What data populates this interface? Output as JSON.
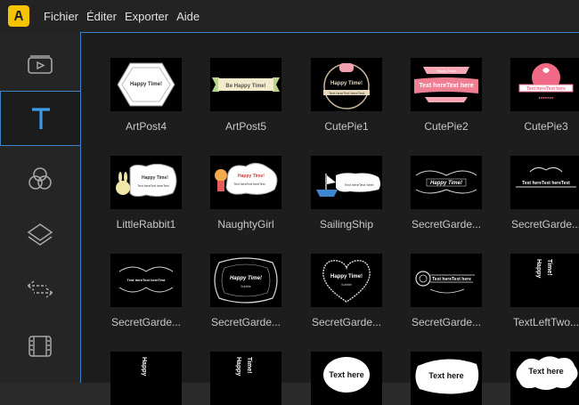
{
  "menu": [
    "Fichier",
    "Éditer",
    "Exporter",
    "Aide"
  ],
  "sidebar": [
    {
      "name": "media-icon",
      "active": false
    },
    {
      "name": "text-icon",
      "active": true
    },
    {
      "name": "filters-icon",
      "active": false
    },
    {
      "name": "overlays-icon",
      "active": false
    },
    {
      "name": "transitions-icon",
      "active": false
    },
    {
      "name": "elements-icon",
      "active": false
    }
  ],
  "thumb_text": {
    "happy": "Happy Time!",
    "be_happy": "Be Happy Time!",
    "text_here": "Text here",
    "text_here_repeat": "Text hereText here",
    "text_here_triple": "Text hereText hereText",
    "subtitle": "Subtitle",
    "vertical_happy": "Happy",
    "vertical_time": "Time!"
  },
  "tiles": [
    {
      "label": "ArtPost4",
      "style": "hexagon"
    },
    {
      "label": "ArtPost5",
      "style": "ribbon"
    },
    {
      "label": "CutePie1",
      "style": "cutepie1"
    },
    {
      "label": "CutePie2",
      "style": "cutepie2"
    },
    {
      "label": "CutePie3",
      "style": "cutepie3"
    },
    {
      "label": "LittleRabbit1",
      "style": "rabbit"
    },
    {
      "label": "NaughtyGirl",
      "style": "girl"
    },
    {
      "label": "SailingShip",
      "style": "ship"
    },
    {
      "label": "SecretGarde...",
      "style": "garden1"
    },
    {
      "label": "SecretGarde...",
      "style": "garden2"
    },
    {
      "label": "SecretGarde...",
      "style": "garden3"
    },
    {
      "label": "SecretGarde...",
      "style": "garden4"
    },
    {
      "label": "SecretGarde...",
      "style": "garden5"
    },
    {
      "label": "SecretGarde...",
      "style": "garden6"
    },
    {
      "label": "TextLeftTwo...",
      "style": "vertical"
    },
    {
      "label": "",
      "style": "vertical2"
    },
    {
      "label": "",
      "style": "vertical3"
    },
    {
      "label": "",
      "style": "bubble1"
    },
    {
      "label": "",
      "style": "bubble2"
    },
    {
      "label": "",
      "style": "bubble3"
    }
  ]
}
